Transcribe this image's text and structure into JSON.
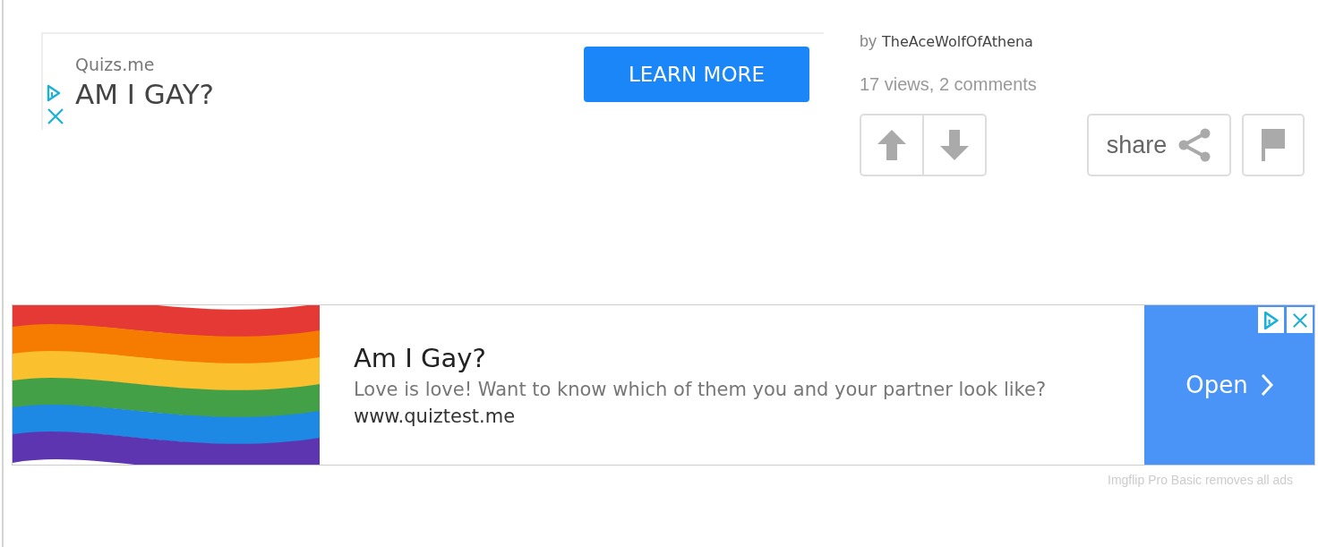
{
  "top_ad": {
    "brand": "Quizs.me",
    "headline": "AM I GAY?",
    "button": "LEARN MORE"
  },
  "meta": {
    "by": "by",
    "author": "TheAceWolfOfAthena",
    "stats": "17 views, 2 comments"
  },
  "actions": {
    "share": "share"
  },
  "bottom_ad": {
    "title": "Am I Gay?",
    "description": "Love is love! Want to know which of them you and your partner look like?",
    "url": "www.quiztest.me",
    "button": "Open"
  },
  "footer_note": "Imgflip Pro Basic removes all ads"
}
